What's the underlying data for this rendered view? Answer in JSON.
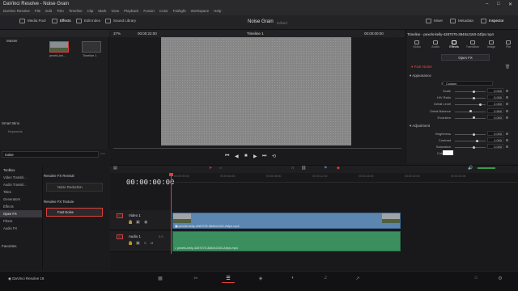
{
  "app": {
    "title": "DaVinci Resolve - Noise Grain",
    "brand": "DaVinci Resolve 18"
  },
  "menu": [
    "DaVinci Resolve",
    "File",
    "Edit",
    "Trim",
    "Timeline",
    "Clip",
    "Mark",
    "View",
    "Playback",
    "Fusion",
    "Color",
    "Fairlight",
    "Workspace",
    "Help"
  ],
  "toolbar": {
    "media_pool": "Media Pool",
    "effects": "Effects",
    "edit_index": "Edit Index",
    "sound_library": "Sound Library",
    "project_title": "Noise Grain",
    "edited": "Edited",
    "mixer": "Mixer",
    "metadata": "Metadata",
    "inspector": "Inspector"
  },
  "media_pool": {
    "master": "Master",
    "clips": [
      {
        "label": "pexels-kel..."
      },
      {
        "label": "Timeline 1"
      }
    ],
    "smart_bins": "Smart Bins",
    "keywords": "Keywords"
  },
  "viewer": {
    "zoom": "37%",
    "src_timecode": "00:00:22:00",
    "timeline_name": "Timeline 1",
    "rec_timecode": "00:00:00:00"
  },
  "effects_library": {
    "search_value": "noise",
    "tree": [
      "Toolbox",
      "Video Transiti...",
      "Audio Transiti...",
      "Titles",
      "Generators",
      "Effects",
      "Open FX",
      "Filters",
      "Audio FX"
    ],
    "selected_tree": "Open FX",
    "group1": "Resolve FX Revival",
    "item1": "Noise Reduction",
    "group2": "Resolve FX Texture",
    "item2": "Fast Noise",
    "favorites": "Favorites"
  },
  "inspector": {
    "clip_title": "Timeline - pexels-kelly-4287075-3840x2160-24fps.mp4",
    "tabs": [
      "Video",
      "Audio",
      "Effects",
      "Transition",
      "Image",
      "File"
    ],
    "active_tab": "Effects",
    "open_fx": "Open FX",
    "fx_name": "Fast Noise",
    "appearance": "Appearance",
    "preset_label": "Preset",
    "preset_value": "Custom",
    "params": [
      {
        "label": "Scale",
        "value": "0.000"
      },
      {
        "label": "H/V Ratio",
        "value": "0.000"
      },
      {
        "label": "Detail Level",
        "value": "2.000"
      },
      {
        "label": "Detail Balance",
        "value": "0.500"
      },
      {
        "label": "Evolution",
        "value": "0.000"
      }
    ],
    "adjustment": "Adjustment",
    "adj_params": [
      {
        "label": "Brightness",
        "value": "0.000"
      },
      {
        "label": "Contrast",
        "value": "1.000"
      },
      {
        "label": "Saturation",
        "value": "0.000"
      }
    ],
    "color_tint_label": "Color Tint"
  },
  "timeline": {
    "timecode": "00:00:00:00",
    "ruler": [
      "00:00:00:00",
      "00:00:04:00",
      "00:00:08:00",
      "00:00:12:00",
      "00:00:16:00",
      "00:00:20:00",
      "00:00:24:00"
    ],
    "video_track": {
      "id": "V1",
      "name": "Video 1"
    },
    "audio_track": {
      "id": "A1",
      "name": "Audio 1",
      "level": "2.0"
    },
    "video_clip": "pexels-kelly-4287075-3840x2160-24fps.mp4",
    "audio_clip": "pexels-kelly-4287075-3840x2160-24fps.mp4"
  },
  "colors": {
    "accent": "#d8403a",
    "video_clip": "#5a86b0",
    "audio_clip": "#3b8f5f"
  }
}
